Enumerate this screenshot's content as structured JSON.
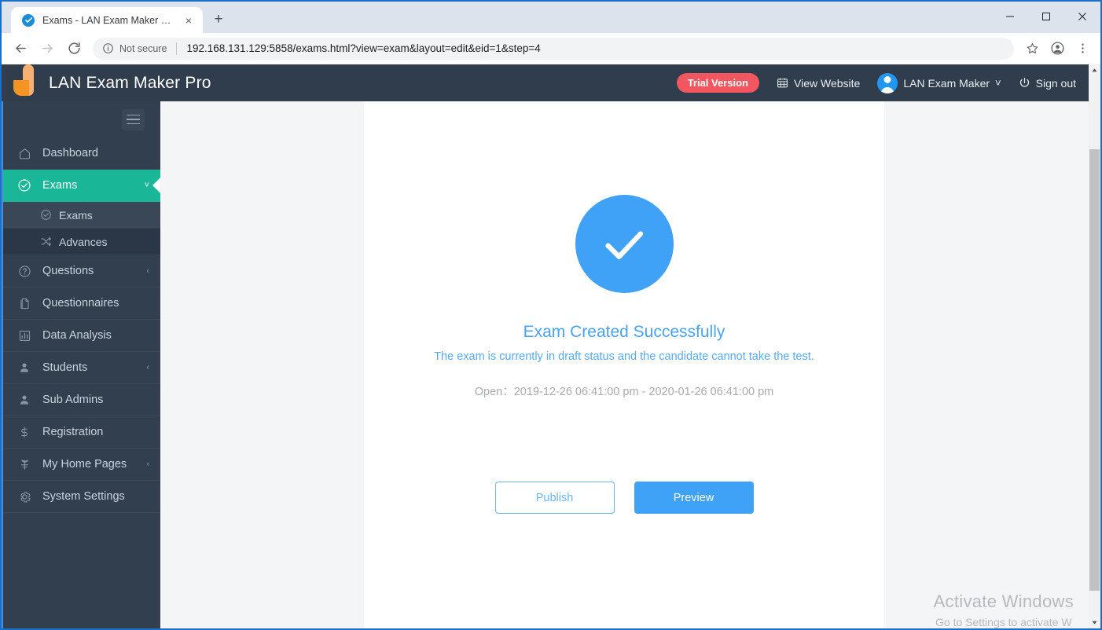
{
  "browser": {
    "tab": {
      "title": "Exams - LAN Exam Maker Pro",
      "favicon": "check-circle-icon",
      "close": "×",
      "new_tab": "+"
    },
    "window_controls": {
      "minimize": "minimize-icon",
      "maximize": "maximize-icon",
      "close": "close-icon"
    },
    "nav": {
      "back": "back-arrow-icon",
      "forward": "forward-arrow-icon",
      "reload": "reload-icon"
    },
    "omnibox": {
      "security_label": "Not secure",
      "security_icon": "info-circle-icon",
      "url": "192.168.131.129:5858/exams.html?view=exam&layout=edit&eid=1&step=4"
    },
    "toolbar_icons": {
      "bookmark": "star-icon",
      "profile": "profile-avatar-icon",
      "menu": "three-dot-menu-icon"
    }
  },
  "app": {
    "header": {
      "logo": "leaf-logo-icon",
      "brand": "LAN Exam Maker Pro",
      "trial_badge": "Trial Version",
      "view_website": "View Website",
      "view_website_icon": "calendar-grid-icon",
      "user_name": "LAN Exam Maker",
      "user_caret": "˅",
      "sign_out": "Sign out",
      "sign_out_icon": "power-icon"
    },
    "sidebar": {
      "toggle": "hamburger-icon",
      "items": [
        {
          "label": "Dashboard",
          "icon": "home-icon",
          "active": false,
          "chevron": ""
        },
        {
          "label": "Exams",
          "icon": "check-circle-icon",
          "active": true,
          "chevron": "˅"
        },
        {
          "label": "Questions",
          "icon": "question-circle-icon",
          "active": false,
          "chevron": "‹"
        },
        {
          "label": "Questionnaires",
          "icon": "file-copy-icon",
          "active": false,
          "chevron": ""
        },
        {
          "label": "Data Analysis",
          "icon": "bar-chart-icon",
          "active": false,
          "chevron": ""
        },
        {
          "label": "Students",
          "icon": "user-icon",
          "active": false,
          "chevron": "‹"
        },
        {
          "label": "Sub Admins",
          "icon": "user-icon",
          "active": false,
          "chevron": ""
        },
        {
          "label": "Registration",
          "icon": "dollar-icon",
          "active": false,
          "chevron": ""
        },
        {
          "label": "My Home Pages",
          "icon": "plant-icon",
          "active": false,
          "chevron": "‹"
        },
        {
          "label": "System Settings",
          "icon": "gear-icon",
          "active": false,
          "chevron": ""
        }
      ],
      "submenu": [
        {
          "label": "Exams",
          "icon": "check-circle-icon",
          "active": true
        },
        {
          "label": "Advances",
          "icon": "shuffle-icon",
          "active": false
        }
      ]
    },
    "main": {
      "status_icon": "success-check-icon",
      "title": "Exam Created Successfully",
      "subtitle": "The exam is currently in draft status and the candidate cannot take the test.",
      "open_label": "Open：",
      "open_range": "2019-12-26 06:41:00 pm - 2020-01-26 06:41:00 pm",
      "buttons": {
        "publish": "Publish",
        "preview": "Preview"
      }
    }
  },
  "watermark": {
    "line1": "Activate Windows",
    "line2": "Go to Settings to activate W"
  },
  "colors": {
    "accent_blue": "#3fa2f7",
    "accent_green": "#19b698",
    "sidebar_bg": "#323f4e",
    "header_bg": "#2f3d4c",
    "trial_red": "#f2575f"
  }
}
